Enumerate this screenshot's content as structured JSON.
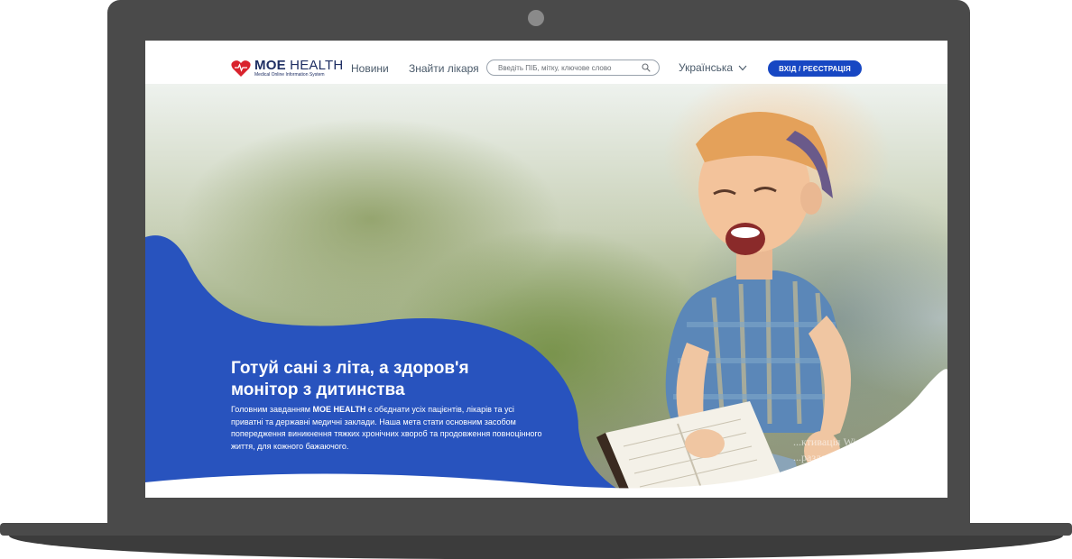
{
  "site": {
    "logo_name_bold": "MOE",
    "logo_name_thin": "HEALTH",
    "logo_subtitle": "Medical Online Information System"
  },
  "nav": {
    "news": "Новини",
    "find_doctor": "Знайти лікаря"
  },
  "search": {
    "placeholder": "Введіть ПІБ, мітку, ключове слово"
  },
  "language": {
    "selected": "Українська"
  },
  "login_button": "ВХІД / РЕЄСТРАЦІЯ",
  "hero": {
    "title_line1": "Готуй сані з літа, а здоров'я",
    "title_line2": "монітор з дитинства",
    "text_before": "Головним завданням ",
    "text_brand": "MOE HEALTH",
    "text_after": " є обєднати усіх пацієнтів, лікарів та усі приватні та державні медичні заклади. Наша мета стати основним засобом попередження виникнення тяжких хронічних хвороб та продовження повноцінного життя, для кожного бажаючого."
  },
  "os_watermark": {
    "line1": "...ктивація Windows",
    "line2": "...разделу \"Настройки\",",
    "line3": "...ировать Windows."
  },
  "colors": {
    "brand_blue": "#1747c3",
    "wave_blue": "#2d5ac7",
    "logo_red": "#d9232d",
    "logo_navy": "#1e2e63",
    "laptop_frame": "#4a4a4a"
  }
}
